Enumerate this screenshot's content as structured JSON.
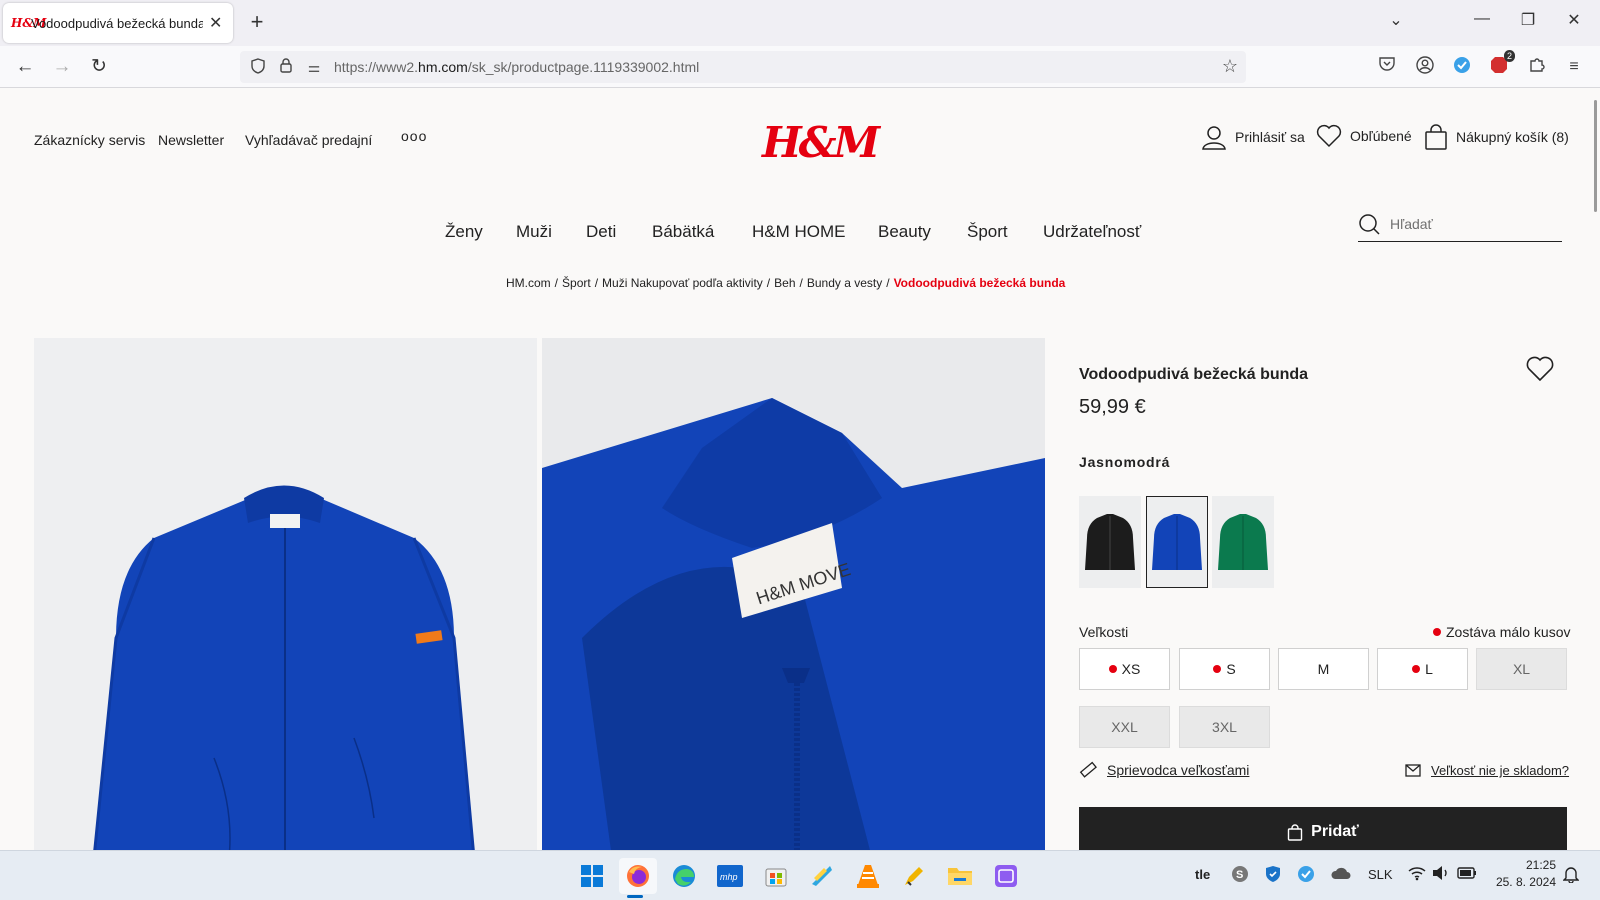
{
  "browser": {
    "tab": {
      "favicon": "H&M",
      "title": "Vodoodpudivá bežecká bunda"
    },
    "url": {
      "prefix": "https://www2.",
      "domain": "hm.com",
      "path": "/sk_sk/productpage.1119339002.html"
    },
    "extension_badge": "2",
    "icons": [
      "back-icon",
      "forward-icon",
      "reload-icon",
      "shield-icon",
      "lock-icon",
      "permissions-icon",
      "bookmark-star-icon",
      "pocket-icon",
      "account-icon",
      "extension-icon",
      "adblock-icon",
      "puzzle-icon",
      "menu-icon"
    ]
  },
  "header": {
    "utility_links": [
      "Zákaznícky servis",
      "Newsletter",
      "Vyhľadávač predajní"
    ],
    "more": "ooo",
    "logo": "H&M",
    "account": "Prihlásiť sa",
    "favorites": "Obľúbené",
    "cart": "Nákupný košík (8)"
  },
  "nav": {
    "items": [
      "Ženy",
      "Muži",
      "Deti",
      "Bábätká",
      "H&M HOME",
      "Beauty",
      "Šport",
      "Udržateľnosť"
    ],
    "search_placeholder": "Hľadať"
  },
  "breadcrumb": {
    "items": [
      "HM.com",
      "Šport",
      "Muži Nakupovať podľa aktivity",
      "Beh",
      "Bundy a vesty"
    ],
    "separator": "/",
    "current": "Vodoodpudivá bežecká bunda"
  },
  "gallery": {
    "label_text": "H&M MOVE"
  },
  "product": {
    "title": "Vodoodpudivá bežecká bunda",
    "price": "59,99 €",
    "color_name": "Jasnomodrá",
    "swatches": [
      {
        "color": "#1c1c1c",
        "selected": false
      },
      {
        "color": "#1244b8",
        "selected": true
      },
      {
        "color": "#0b7a4e",
        "selected": false
      }
    ],
    "sizes_label": "Veľkosti",
    "low_stock": "Zostáva málo kusov",
    "sizes": [
      {
        "label": "XS",
        "low_stock": true,
        "available": true
      },
      {
        "label": "S",
        "low_stock": true,
        "available": true
      },
      {
        "label": "M",
        "low_stock": false,
        "available": true
      },
      {
        "label": "L",
        "low_stock": true,
        "available": true
      },
      {
        "label": "XL",
        "low_stock": false,
        "available": false
      },
      {
        "label": "XXL",
        "low_stock": false,
        "available": false
      },
      {
        "label": "3XL",
        "low_stock": false,
        "available": false
      }
    ],
    "size_guide": "Sprievodca veľkosťami",
    "size_notify": "Veľkosť nie je skladom?",
    "add_button": "Pridať"
  },
  "colors": {
    "brand": "#e50010",
    "jacket": "#1244b8",
    "button": "#222222"
  },
  "taskbar": {
    "apps": [
      "start-icon",
      "firefox-icon",
      "edge-icon",
      "mhp-icon",
      "store-icon",
      "calculator-icon",
      "vlc-icon",
      "pen-icon",
      "folder-icon",
      "remote-icon"
    ],
    "tray_text": "tle",
    "language": "SLK",
    "time": "21:25",
    "date": "25. 8. 2024"
  }
}
